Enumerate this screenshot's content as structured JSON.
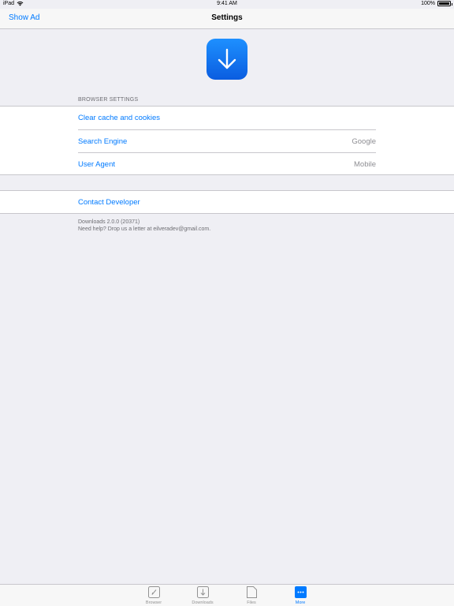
{
  "status_bar": {
    "device": "iPad",
    "time": "9:41 AM",
    "battery": "100%",
    "battery_level": 1.0
  },
  "nav": {
    "left_button": "Show Ad",
    "title": "Settings"
  },
  "app_icon": {
    "icon": "download-arrow-icon",
    "color": "#1e7cf5"
  },
  "browser_settings": {
    "header": "BROWSER SETTINGS",
    "rows": [
      {
        "label": "Clear cache and cookies",
        "value": ""
      },
      {
        "label": "Search Engine",
        "value": "Google"
      },
      {
        "label": "User Agent",
        "value": "Mobile"
      }
    ]
  },
  "contact": {
    "label": "Contact Developer"
  },
  "footer": {
    "version": "Downloads 2.0.0 (20371)",
    "help": "Need help? Drop us a letter at eilveradev@gmail.com."
  },
  "tabs": [
    {
      "label": "Browser",
      "icon": "compass-icon",
      "active": false
    },
    {
      "label": "Downloads",
      "icon": "download-icon",
      "active": false
    },
    {
      "label": "Files",
      "icon": "file-icon",
      "active": false
    },
    {
      "label": "More",
      "icon": "more-icon",
      "active": true
    }
  ],
  "colors": {
    "accent": "#007aff",
    "background": "#efeff4",
    "secondary_text": "#8e8e93"
  }
}
